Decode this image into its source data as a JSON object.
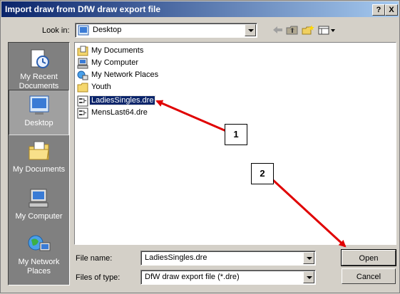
{
  "window": {
    "title": "Import draw from DfW draw export file",
    "help_button": "?",
    "close_button": "X"
  },
  "look_in": {
    "label": "Look in:",
    "value": "Desktop"
  },
  "toolbar": {
    "icons": [
      "back-icon",
      "up-folder-icon",
      "new-folder-icon",
      "view-menu-icon"
    ]
  },
  "places": [
    {
      "label": "My Recent Documents",
      "icon": "recent-documents-icon"
    },
    {
      "label": "Desktop",
      "icon": "desktop-icon",
      "selected": true
    },
    {
      "label": "My Documents",
      "icon": "my-documents-icon"
    },
    {
      "label": "My Computer",
      "icon": "my-computer-icon"
    },
    {
      "label": "My Network Places",
      "icon": "network-places-icon"
    }
  ],
  "files": [
    {
      "name": "My Documents",
      "icon": "my-documents-icon"
    },
    {
      "name": "My Computer",
      "icon": "my-computer-icon"
    },
    {
      "name": "My Network Places",
      "icon": "network-places-icon"
    },
    {
      "name": "Youth",
      "icon": "folder-icon"
    },
    {
      "name": "LadiesSingles.dre",
      "icon": "dre-file-icon",
      "selected": true
    },
    {
      "name": "MensLast64.dre",
      "icon": "dre-file-icon"
    }
  ],
  "file_name": {
    "label": "File name:",
    "value": "LadiesSingles.dre"
  },
  "files_of_type": {
    "label": "Files of type:",
    "value": "DfW draw export file (*.dre)"
  },
  "buttons": {
    "open": "Open",
    "cancel": "Cancel"
  },
  "callouts": [
    "1",
    "2"
  ],
  "colors": {
    "title_start": "#0a246a",
    "title_end": "#a6caf0",
    "selection": "#0a246a",
    "arrow": "#e00000",
    "dialog_bg": "#d4d0c8"
  }
}
